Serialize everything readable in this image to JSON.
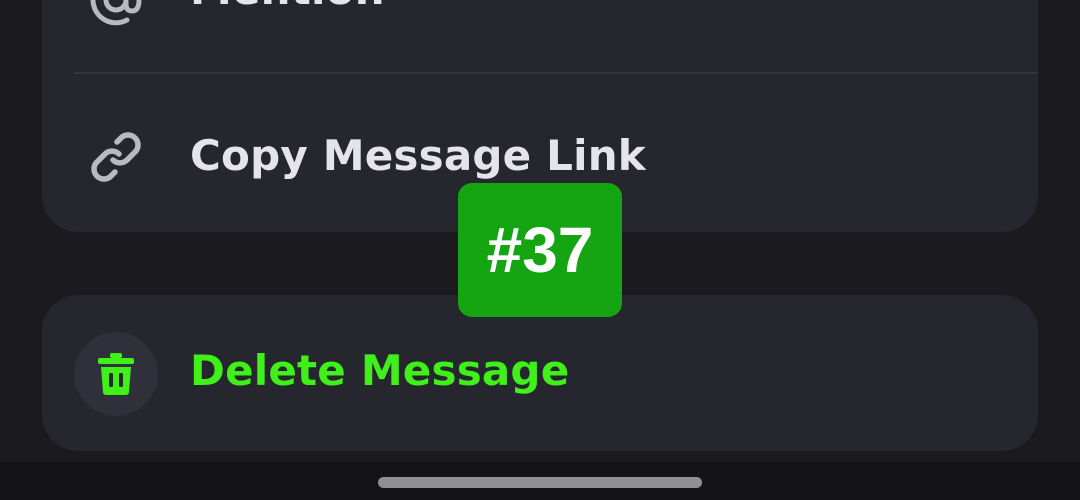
{
  "menu": {
    "mention_label": "Mention",
    "copy_link_label": "Copy Message Link",
    "delete_label": "Delete Message"
  },
  "overlay": {
    "badge_text": "#37"
  },
  "icons": {
    "mention": "at-sign-icon",
    "copy_link": "link-icon",
    "delete": "trash-icon"
  },
  "colors": {
    "background": "#1b1b1f",
    "card": "#26262e",
    "text": "#e4e4ea",
    "danger_accent": "#3ff019",
    "badge": "#15a512"
  }
}
